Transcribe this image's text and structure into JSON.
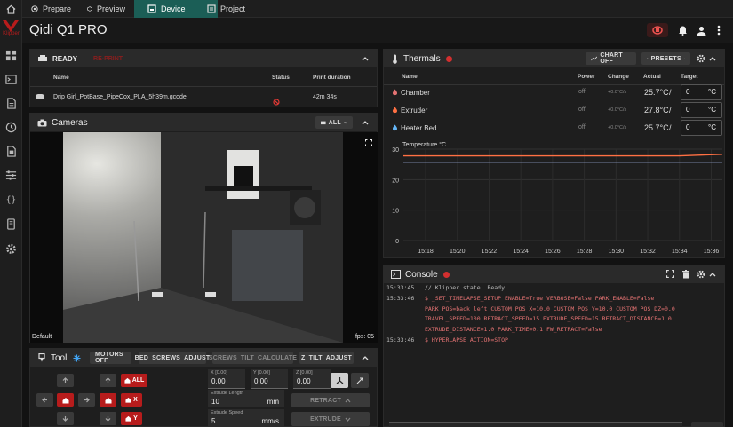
{
  "nav": {
    "tabs": [
      {
        "label": "Prepare",
        "icon": "prepare-icon"
      },
      {
        "label": "Preview",
        "icon": "preview-icon"
      },
      {
        "label": "Device",
        "icon": "device-icon",
        "active": true
      },
      {
        "label": "Project",
        "icon": "project-icon"
      }
    ]
  },
  "sidebar": {
    "logo_text": "Klipper",
    "items": [
      "dashboard-icon",
      "console-icon",
      "files-icon",
      "history-icon",
      "jobs-icon",
      "tune-icon",
      "macros-icon",
      "device-settings-icon",
      "settings-icon"
    ]
  },
  "header": {
    "title": "Qidi Q1 PRO"
  },
  "status": {
    "state": "READY",
    "reprint_label": "RE-PRINT",
    "col_name": "Name",
    "col_status": "Status",
    "col_duration": "Print duration",
    "file_name": "Drip Girl_PotBase_PipeCox_PLA_5h39m.gcode",
    "duration": "42m 34s"
  },
  "cameras": {
    "title": "Cameras",
    "filter_label": "ALL",
    "camera_name": "Default",
    "fps": "fps: 05"
  },
  "tool": {
    "title": "Tool",
    "motors_off": "MOTORS OFF",
    "bed_screws": "BED_SCREWS_ADJUST",
    "screws_tilt": "SCREWS_TILT_CALCULATE",
    "z_tilt": "Z_TILT_ADJUST",
    "home_all": "ALL",
    "home_x": "X",
    "home_y": "Y",
    "x_label": "X [0.00]",
    "x_value": "0.00",
    "y_label": "Y [0.00]",
    "y_value": "0.00",
    "z_label": "Z [0.00]",
    "z_value": "0.00",
    "extrude_length_label": "Extrude Length",
    "extrude_length": "10",
    "extrude_length_unit": "mm",
    "extrude_speed_label": "Extrude Speed",
    "extrude_speed": "5",
    "extrude_speed_unit": "mm/s",
    "retract": "RETRACT",
    "extrude": "EXTRUDE"
  },
  "thermals": {
    "title": "Thermals",
    "chart_off": "CHART OFF",
    "presets": "PRESETS",
    "col_name": "Name",
    "col_power": "Power",
    "col_change": "Change",
    "col_actual": "Actual",
    "col_target": "Target",
    "rows": [
      {
        "name": "Chamber",
        "power": "off",
        "change": "+0.0°C/s",
        "actual": "25.7°C",
        "sep": "/",
        "target": "0",
        "unit": "°C",
        "color": "#e57373"
      },
      {
        "name": "Extruder",
        "power": "off",
        "change": "+0.0°C/s",
        "actual": "27.8°C",
        "sep": "/",
        "target": "0",
        "unit": "°C",
        "color": "#ff7043"
      },
      {
        "name": "Heater Bed",
        "power": "off",
        "change": "+0.0°C/s",
        "actual": "25.7°C",
        "sep": "/",
        "target": "0",
        "unit": "°C",
        "color": "#64b5f6"
      }
    ]
  },
  "chart_data": {
    "type": "line",
    "ylabel": "Temperature °C",
    "yticks": [
      "30",
      "20",
      "10",
      "0"
    ],
    "ylim": [
      0,
      30
    ],
    "x": [
      "15:18",
      "15:20",
      "15:22",
      "15:24",
      "15:26",
      "15:28",
      "15:30",
      "15:32",
      "15:34",
      "15:36"
    ],
    "series": [
      {
        "values": [
          27.8,
          27.8,
          27.8,
          27.8,
          27.8,
          27.8,
          27.8,
          27.8,
          27.8,
          28.3
        ],
        "color": "#ff7043"
      },
      {
        "values": [
          25.7,
          25.7,
          25.7,
          25.7,
          25.7,
          25.7,
          25.7,
          25.7,
          25.7,
          25.7
        ],
        "color": "#e57373"
      },
      {
        "values": [
          25.7,
          25.7,
          25.7,
          25.7,
          25.7,
          25.7,
          25.7,
          25.7,
          25.7,
          25.7
        ],
        "color": "#64b5f6"
      }
    ]
  },
  "console": {
    "title": "Console",
    "lines": [
      {
        "time": "15:33:45",
        "text": "// Klipper state: Ready",
        "color": "#bdbdbd"
      },
      {
        "time": "15:33:46",
        "text": "$ _SET_TIMELAPSE_SETUP ENABLE=True VERBOSE=False PARK_ENABLE=False",
        "color": "#e57373"
      },
      {
        "time": "",
        "text": "PARK_POS=back_left CUSTOM_POS_X=10.0 CUSTOM_POS_Y=10.0 CUSTOM_POS_DZ=0.0",
        "color": "#e57373"
      },
      {
        "time": "",
        "text": "TRAVEL_SPEED=100 RETRACT_SPEED=15 EXTRUDE_SPEED=15 RETRACT_DISTANCE=1.0",
        "color": "#e57373"
      },
      {
        "time": "",
        "text": "EXTRUDE_DISTANCE=1.0 PARK_TIME=0.1 FW_RETRACT=False",
        "color": "#e57373"
      },
      {
        "time": "15:33:46",
        "text": "$ HYPERLAPSE ACTION=STOP",
        "color": "#e57373"
      }
    ]
  }
}
